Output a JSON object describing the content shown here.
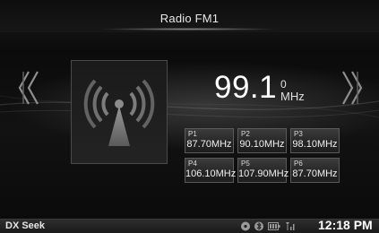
{
  "header": {
    "title": "Radio FM1"
  },
  "tuner": {
    "frequency_main": "99.1",
    "frequency_small": "0",
    "unit": "MHz"
  },
  "presets": [
    {
      "label": "P1",
      "freq": "87.70MHz"
    },
    {
      "label": "P2",
      "freq": "90.10MHz"
    },
    {
      "label": "P3",
      "freq": "98.10MHz"
    },
    {
      "label": "P4",
      "freq": "106.10MHz"
    },
    {
      "label": "P5",
      "freq": "107.90MHz"
    },
    {
      "label": "P6",
      "freq": "87.70MHz"
    }
  ],
  "status_bar": {
    "mode": "DX Seek",
    "time": "12:18 PM",
    "icons": [
      "disc-icon",
      "bluetooth-icon",
      "battery-icon",
      "signal-icon"
    ]
  },
  "colors": {
    "background": "#101010",
    "text": "#f2f2f2",
    "preset_border": "#5a5a5a"
  }
}
